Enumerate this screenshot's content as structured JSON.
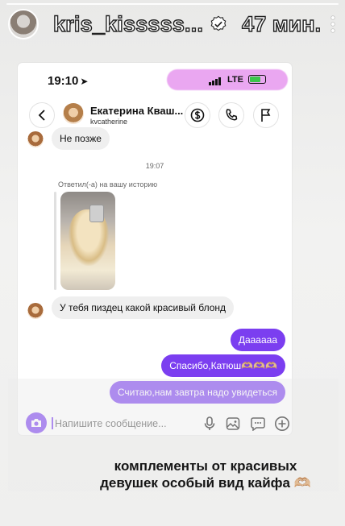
{
  "story": {
    "username": "kris_kisssss...",
    "time_ago": "47 мин."
  },
  "status_bar": {
    "time": "19:10",
    "network": "LTE"
  },
  "chat": {
    "contact_name": "Екатерина Кваш...",
    "contact_handle": "kvcatherine",
    "messages": {
      "m1": "Не позже",
      "time_separator": "19:07",
      "reply_label": "Ответил(-а) на вашу историю",
      "m2": "У тебя пиздец какой красивый блонд",
      "m3": "Даааааа",
      "m4": "Спасибо,Катюш🫶🏼🫶🏼🫶🏼",
      "m5": "Считаю,нам завтра надо увидеться"
    },
    "input_placeholder": "Напишите сообщение..."
  },
  "caption": {
    "line1": "комплементы от красивых",
    "line2": "девушек особый вид кайфа 🫶🏼"
  },
  "colors": {
    "accent": "#7b3ef0",
    "incoming_bubble": "#efefef",
    "status_highlight": "#d85fe6"
  }
}
